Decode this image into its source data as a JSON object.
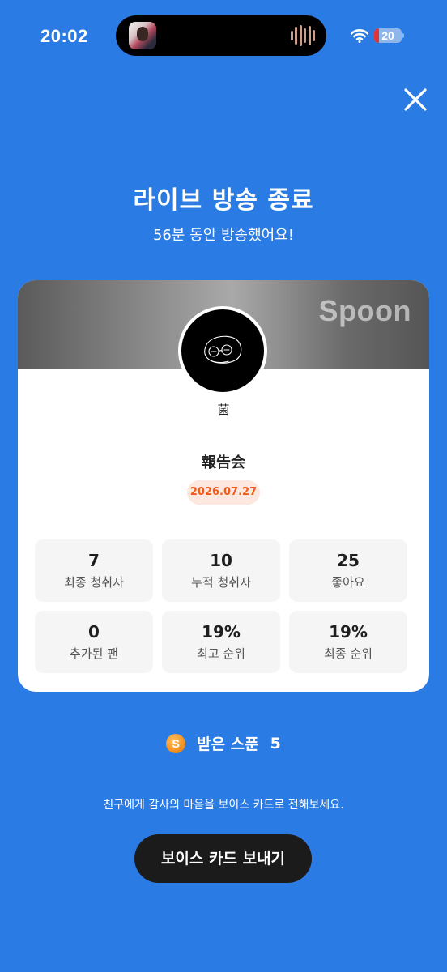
{
  "status_bar": {
    "time": "20:02",
    "battery": "20",
    "icons": [
      "wifi-icon",
      "battery-icon",
      "audio-wave-icon"
    ]
  },
  "colors": {
    "background": "#2a7be3",
    "date_badge_text": "#f25b1d",
    "button": "#1b1b1b"
  },
  "header": {
    "title": "라이브 방송 종료",
    "subtitle": "56분 동안 방송했어요!"
  },
  "card": {
    "brand": "Spoon",
    "host_name": "菌",
    "broadcast_title": "報告会",
    "date": "2026.07.27",
    "stats": [
      {
        "value": "7",
        "label": "최종 청취자"
      },
      {
        "value": "10",
        "label": "누적 청취자"
      },
      {
        "value": "25",
        "label": "좋아요"
      },
      {
        "value": "0",
        "label": "추가된 팬"
      },
      {
        "value": "19%",
        "label": "최고 순위"
      },
      {
        "value": "19%",
        "label": "최종 순위"
      }
    ]
  },
  "spoons": {
    "icon_letter": "S",
    "label": "받은 스푼",
    "count": "5"
  },
  "footer": {
    "message": "친구에게 감사의 마음을 보이스 카드로 전해보세요.",
    "button_label": "보이스 카드 보내기"
  }
}
